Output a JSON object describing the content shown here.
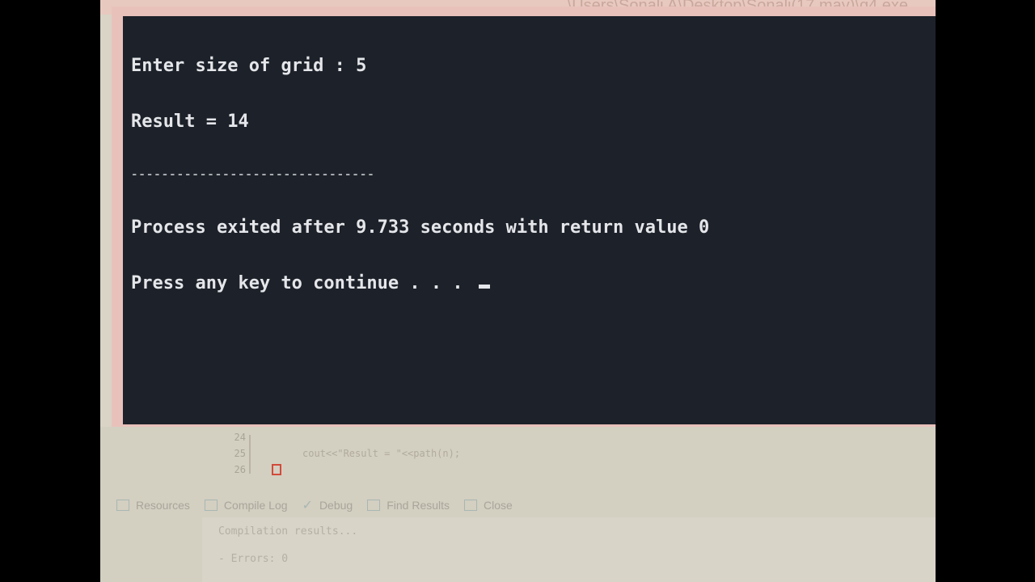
{
  "window": {
    "title_fragment": "\\Users\\Sonali A\\Desktop\\Sonali(17 may)\\q4.exe"
  },
  "console": {
    "lines": [
      "Enter size of grid : 5",
      "Result = 14"
    ],
    "separator": "--------------------------------",
    "exit_message": "Process exited after 9.733 seconds with return value 0",
    "continue_prompt": "Press any key to continue . . . "
  },
  "editor": {
    "line_numbers": [
      "24",
      "25",
      "26"
    ],
    "code_lines": [
      "",
      "cout<<\"Result = \"<<path(n);",
      ""
    ]
  },
  "bottom_tabs": [
    {
      "label": "Resources",
      "icon": "resources-icon"
    },
    {
      "label": "Compile Log",
      "icon": "compile-log-icon"
    },
    {
      "label": "Debug",
      "icon": "debug-check-icon"
    },
    {
      "label": "Find Results",
      "icon": "find-results-icon"
    },
    {
      "label": "Close",
      "icon": "close-icon"
    }
  ],
  "compile_log": {
    "line1": "Compilation results...",
    "line2": "- Errors: 0"
  },
  "colors": {
    "console_bg": "#1d2129",
    "console_text": "#e4e6ea",
    "frame_pink": "#e8c1bb",
    "breakpoint_red": "#d24a3a"
  }
}
